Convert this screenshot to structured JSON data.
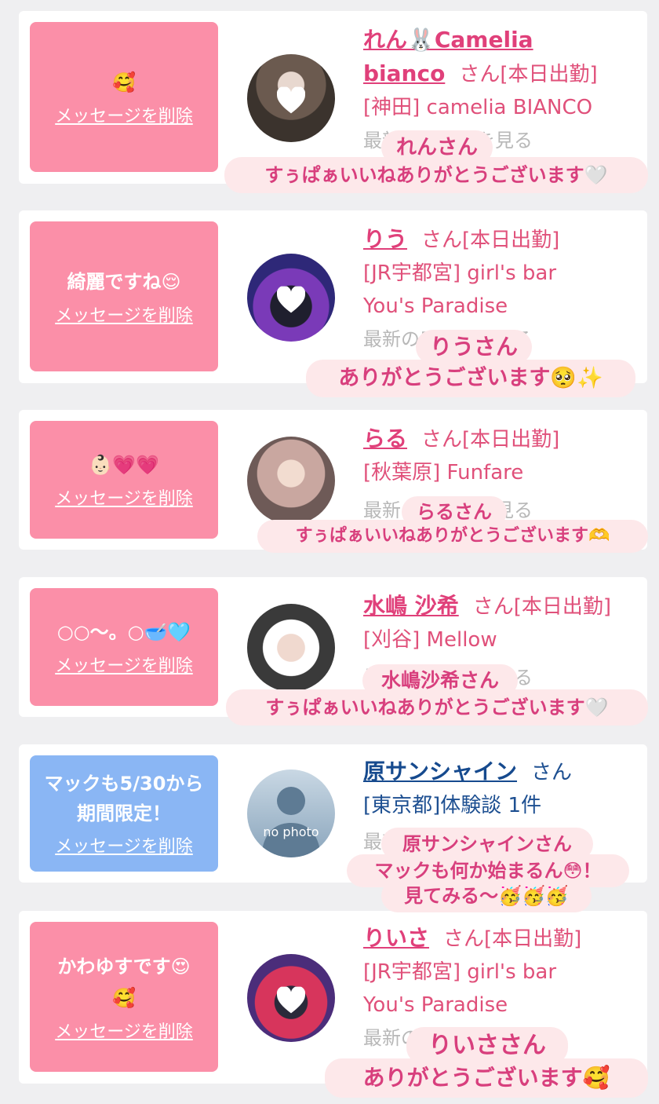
{
  "delete_label": "メッセージを削除",
  "colors": {
    "pink_bubble": "#fb8fa8",
    "blue_bubble": "#8ab6f4",
    "name_pink": "#e0407a",
    "name_blue": "#164a8e",
    "sticker_bg": "#fde8ea",
    "sticker_text": "#d83f7d"
  },
  "cards": [
    {
      "message": "🥰",
      "name_line1": "れん🐰Camelia",
      "name_line2": "bianco",
      "suffix": "さん[本日出勤]",
      "shop": "[神田] camelia BIANCO",
      "latest": "最新の口コミを見る",
      "sticker_name": "れんさん",
      "sticker_text": "すぅぱぁいいねありがとうございます🤍"
    },
    {
      "message": "綺麗ですね😌",
      "name": "りう",
      "suffix": "さん[本日出勤]",
      "shop_line1": "[JR宇都宮] girl's bar",
      "shop_line2": "You's Paradise",
      "latest": "最新の口コミを見る",
      "sticker_name": "りうさん",
      "sticker_text": "ありがとうございます🥺✨"
    },
    {
      "message": "👶🏻💗💗",
      "name": "らる",
      "suffix": "さん[本日出勤]",
      "shop": "[秋葉原] Funfare",
      "latest": "最新の口コミを見る",
      "sticker_name": "らるさん",
      "sticker_text": "すぅぱぁいいねありがとうございます🫶"
    },
    {
      "message": "○○︎︎〜。○🥣🩵",
      "name": "水嶋 沙希",
      "suffix": "さん[本日出勤]",
      "shop": "[刈谷] Mellow",
      "latest": "最新の口コミを見る",
      "sticker_name": "水嶋沙希さん",
      "sticker_text": "すぅぱぁいいねありがとうございます🤍"
    },
    {
      "message": "マックも5/30から期間限定！",
      "name": "原サンシャイン",
      "suffix": "さん",
      "shop": "[東京都]体験談 1件",
      "avatar_label": "no photo",
      "latest": "最新の口コミを見る",
      "sticker_line1": "原サンシャインさん",
      "sticker_line2": "マックも何か始まるん😳！",
      "sticker_line3": "見てみる〜🥳🥳🥳"
    },
    {
      "message_line1": "かわゆすです😍",
      "message_line2": "🥰",
      "name": "りいさ",
      "suffix": "さん[本日出勤]",
      "shop_line1": "[JR宇都宮] girl's bar",
      "shop_line2": "You's Paradise",
      "latest": "最新の口コミを見る",
      "sticker_name": "りいささん",
      "sticker_text": "ありがとうございます🥰"
    }
  ]
}
